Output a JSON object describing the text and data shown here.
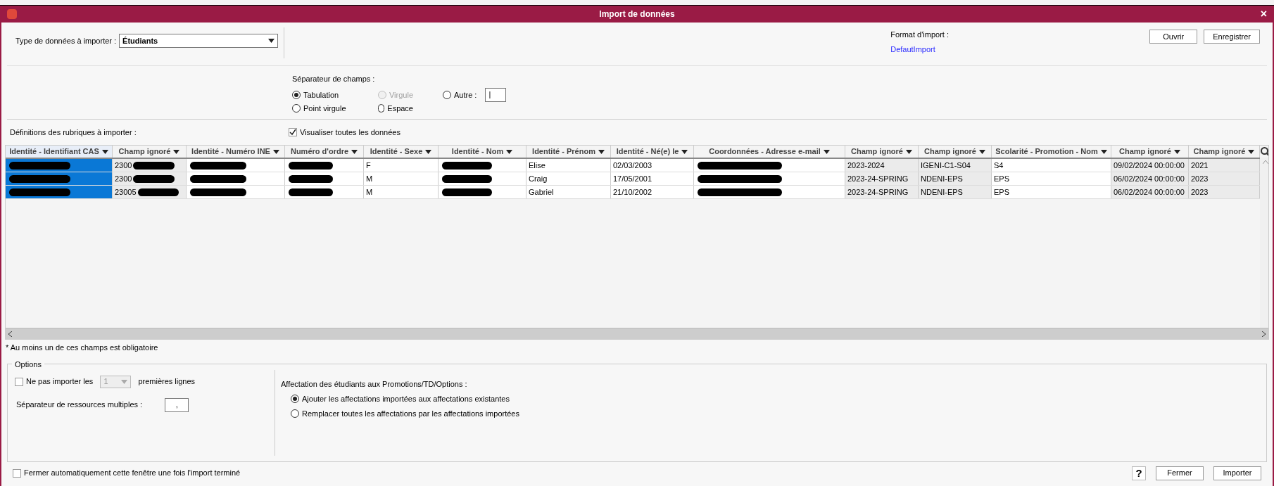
{
  "window": {
    "title": "Import de données",
    "close": "×"
  },
  "header": {
    "type_label": "Type de données à importer :",
    "type_value": "Étudiants",
    "format_label": "Format d'import :",
    "format_link": "DefautImport",
    "buttons": [
      "Ouvrir",
      "Enregistrer"
    ]
  },
  "separator": {
    "label": "Séparateur de champs :",
    "options": [
      {
        "label": "Tabulation",
        "selected": true,
        "disabled": false
      },
      {
        "label": "Point virgule",
        "selected": false,
        "disabled": false
      },
      {
        "label": "Virgule",
        "selected": false,
        "disabled": true
      },
      {
        "label": "Espace",
        "selected": false,
        "disabled": false
      },
      {
        "label": "Autre :",
        "selected": false,
        "disabled": false
      }
    ],
    "other_value": "|"
  },
  "definitions_label": "Définitions des rubriques à importer :",
  "show_all": {
    "label": "Visualiser toutes les données",
    "checked": true
  },
  "table": {
    "columns": [
      {
        "label": "Identité - Identifiant CAS",
        "ignored": false,
        "selected": true
      },
      {
        "label": "Champ ignoré",
        "ignored": true,
        "selected": false
      },
      {
        "label": "Identité - Numéro INE",
        "ignored": false,
        "selected": false
      },
      {
        "label": "Numéro d'ordre",
        "ignored": false,
        "selected": false
      },
      {
        "label": "Identité - Sexe",
        "ignored": false,
        "selected": false
      },
      {
        "label": "Identité - Nom",
        "ignored": false,
        "selected": false
      },
      {
        "label": "Identité - Prénom",
        "ignored": false,
        "selected": false
      },
      {
        "label": "Identité - Né(e) le",
        "ignored": false,
        "selected": false
      },
      {
        "label": "Coordonnées - Adresse e-mail",
        "ignored": false,
        "selected": false
      },
      {
        "label": "Champ ignoré",
        "ignored": true,
        "selected": false
      },
      {
        "label": "Champ ignoré",
        "ignored": true,
        "selected": false
      },
      {
        "label": "Scolarité - Promotion - Nom",
        "ignored": false,
        "selected": false
      },
      {
        "label": "Champ ignoré",
        "ignored": true,
        "selected": false
      },
      {
        "label": "Champ ignoré",
        "ignored": true,
        "selected": false
      }
    ],
    "rows": [
      {
        "cells": [
          {
            "text": "",
            "redacted": true
          },
          {
            "text": "2300",
            "redacted": true
          },
          {
            "text": "",
            "redacted": true
          },
          {
            "text": "",
            "redacted": true
          },
          {
            "text": "F"
          },
          {
            "text": "",
            "redacted": true
          },
          {
            "text": "Elise"
          },
          {
            "text": "02/03/2003"
          },
          {
            "text": "",
            "redacted": true
          },
          {
            "text": "2023-2024"
          },
          {
            "text": "IGENI-C1-S04"
          },
          {
            "text": "S4"
          },
          {
            "text": "09/02/2024 00:00:00"
          },
          {
            "text": "2021"
          }
        ]
      },
      {
        "cells": [
          {
            "text": "",
            "redacted": true
          },
          {
            "text": "2300",
            "redacted": true
          },
          {
            "text": "",
            "redacted": true
          },
          {
            "text": "",
            "redacted": true
          },
          {
            "text": "M"
          },
          {
            "text": "",
            "redacted": true
          },
          {
            "text": "Craig"
          },
          {
            "text": "17/05/2001"
          },
          {
            "text": "",
            "redacted": true
          },
          {
            "text": "2023-24-SPRING"
          },
          {
            "text": "NDENI-EPS"
          },
          {
            "text": "EPS"
          },
          {
            "text": "06/02/2024 00:00:00"
          },
          {
            "text": "2023"
          }
        ]
      },
      {
        "cells": [
          {
            "text": "",
            "redacted": true
          },
          {
            "text": "23005",
            "redacted": true
          },
          {
            "text": "",
            "redacted": true
          },
          {
            "text": "",
            "redacted": true
          },
          {
            "text": "M"
          },
          {
            "text": "",
            "redacted": true
          },
          {
            "text": "Gabriel"
          },
          {
            "text": "21/10/2002"
          },
          {
            "text": "",
            "redacted": true
          },
          {
            "text": "2023-24-SPRING"
          },
          {
            "text": "NDENI-EPS"
          },
          {
            "text": "EPS"
          },
          {
            "text": "06/02/2024 00:00:00"
          },
          {
            "text": "2023"
          }
        ]
      }
    ]
  },
  "note": "* Au moins un de ces champs est obligatoire",
  "options": {
    "title": "Options",
    "skip_lines": {
      "label": "Ne pas importer les",
      "checked": false,
      "value": "1",
      "suffix": "premières lignes"
    },
    "multi_sep": {
      "label": "Séparateur de ressources multiples :",
      "value": ","
    },
    "assign": {
      "label": "Affectation des étudiants aux Promotions/TD/Options :",
      "options": [
        {
          "label": "Ajouter les affectations importées aux affectations existantes",
          "selected": true
        },
        {
          "label": "Remplacer toutes les affectations par les affectations importées",
          "selected": false
        }
      ]
    }
  },
  "footer": {
    "auto_close": {
      "label": "Fermer automatiquement cette fenêtre une fois l'import terminé",
      "checked": false
    },
    "help": "?",
    "buttons": [
      "Fermer",
      "Importer"
    ]
  }
}
